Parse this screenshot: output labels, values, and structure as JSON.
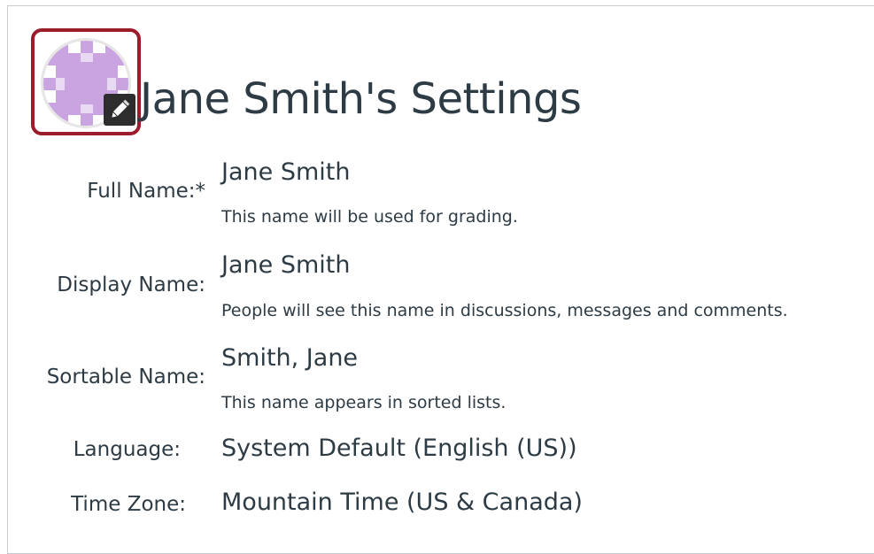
{
  "profile": {
    "title": "Jane Smith's Settings",
    "avatar_alt": "Profile picture",
    "edit_icon": "pencil-icon"
  },
  "fields": {
    "full_name": {
      "label": "Full Name:*",
      "value": "Jane Smith",
      "hint": "This name will be used for grading."
    },
    "display_name": {
      "label": "Display Name:",
      "value": "Jane Smith",
      "hint": "People will see this name in discussions, messages and comments."
    },
    "sortable_name": {
      "label": "Sortable Name:",
      "value": "Smith, Jane",
      "hint": "This name appears in sorted lists."
    },
    "language": {
      "label": "Language:",
      "value": "System Default (English (US))"
    },
    "time_zone": {
      "label": "Time Zone:",
      "value": "Mountain Time (US & Canada)"
    }
  },
  "colors": {
    "highlight_border": "#9b1c2b",
    "avatar_purple": "#c39fdc",
    "text": "#2d3b45"
  }
}
